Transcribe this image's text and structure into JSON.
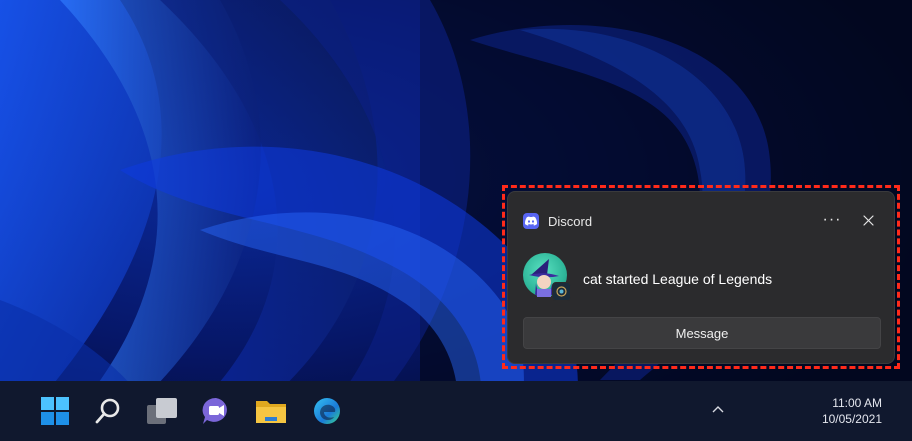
{
  "notification": {
    "app_name": "Discord",
    "message": "cat started League of Legends",
    "more_label": "···",
    "action_label": "Message"
  },
  "taskbar": {
    "icons": [
      "start-icon",
      "search-icon",
      "task-view-icon",
      "teams-chat-icon",
      "file-explorer-icon",
      "edge-icon"
    ],
    "tray_chevron_icon": "chevron-up-icon"
  },
  "clock": {
    "time": "11:00 AM",
    "date": "10/05/2021"
  },
  "colors": {
    "discord_blurple": "#5865f2",
    "toast_bg": "#2b2b2d",
    "highlight_border": "#ff2a1a",
    "taskbar_bg": "#10182e"
  }
}
